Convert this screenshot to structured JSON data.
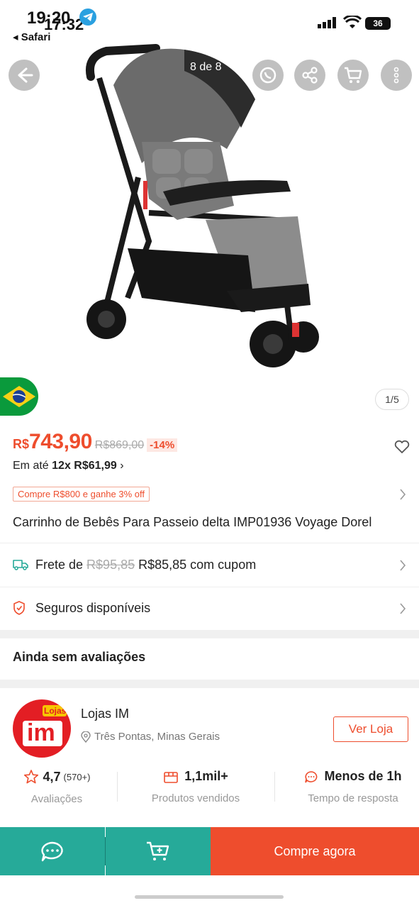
{
  "status_bar": {
    "time_primary": "19:20",
    "time_secondary": "17:32",
    "back_app": "◂ Safari",
    "battery": "36"
  },
  "gallery": {
    "counter": "8 de 8",
    "page_indicator": "1/5"
  },
  "product": {
    "currency": "R$",
    "price": "743,90",
    "old_price": "R$869,00",
    "discount": "-14%",
    "installment_prefix": "Em até ",
    "installment_bold": "12x R$61,99",
    "installment_suffix": " ›",
    "promo": "Compre R$800 e ganhe 3% off",
    "title": "Carrinho de Bebês Para Passeio delta IMP01936 Voyage Dorel"
  },
  "shipping": {
    "prefix": "Frete de",
    "old": "R$95,85",
    "current": "R$85,85 com cupom"
  },
  "insurance": {
    "label": "Seguros disponíveis"
  },
  "reviews": {
    "title": "Ainda sem avaliações"
  },
  "shop": {
    "logo_text_top": "Lojas",
    "logo_text_main": "im",
    "name": "Lojas IM",
    "location": "Três Pontas, Minas Gerais",
    "visit_button": "Ver Loja",
    "stats": [
      {
        "value": "4,7",
        "extra": "(570+)",
        "label": "Avaliações"
      },
      {
        "value": "1,1mil+",
        "extra": "",
        "label": "Produtos vendidos"
      },
      {
        "value": "Menos de 1h",
        "extra": "",
        "label": "Tempo de resposta"
      }
    ]
  },
  "bottom_bar": {
    "buy_label": "Compre agora"
  },
  "colors": {
    "accent": "#ee4d2d",
    "teal": "#26aa99"
  }
}
